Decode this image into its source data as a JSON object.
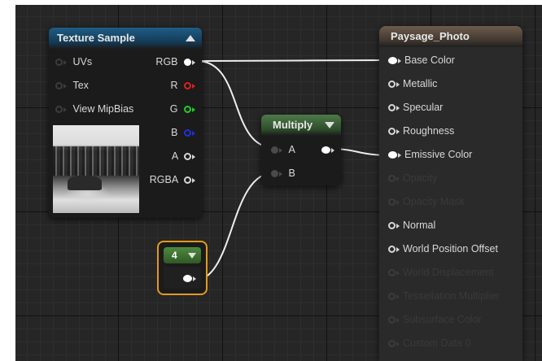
{
  "texture_node": {
    "title": "Texture Sample",
    "inputs": [
      {
        "label": "UVs"
      },
      {
        "label": "Tex"
      },
      {
        "label": "View MipBias"
      }
    ],
    "outputs": [
      {
        "label": "RGB",
        "color": "#ffffff"
      },
      {
        "label": "R",
        "color": "#e02020"
      },
      {
        "label": "G",
        "color": "#20d020"
      },
      {
        "label": "B",
        "color": "#2030e0"
      },
      {
        "label": "A",
        "color": "#d8d8d8"
      },
      {
        "label": "RGBA",
        "color": "#d8d8d8"
      }
    ]
  },
  "multiply_node": {
    "title": "Multiply",
    "inputs": [
      {
        "label": "A"
      },
      {
        "label": "B"
      }
    ]
  },
  "constant_node": {
    "value": "4"
  },
  "material_node": {
    "title": "Paysage_Photo",
    "pins": [
      {
        "label": "Base Color",
        "enabled": true,
        "connected": true
      },
      {
        "label": "Metallic",
        "enabled": true,
        "connected": false
      },
      {
        "label": "Specular",
        "enabled": true,
        "connected": false
      },
      {
        "label": "Roughness",
        "enabled": true,
        "connected": false
      },
      {
        "label": "Emissive Color",
        "enabled": true,
        "connected": true
      },
      {
        "label": "Opacity",
        "enabled": false,
        "connected": false
      },
      {
        "label": "Opacity Mask",
        "enabled": false,
        "connected": false
      },
      {
        "label": "Normal",
        "enabled": true,
        "connected": false
      },
      {
        "label": "World Position Offset",
        "enabled": true,
        "connected": false
      },
      {
        "label": "World Displacement",
        "enabled": false,
        "connected": false
      },
      {
        "label": "Tessellation Multiplier",
        "enabled": false,
        "connected": false
      },
      {
        "label": "Subsurface Color",
        "enabled": false,
        "connected": false
      },
      {
        "label": "Custom Data 0",
        "enabled": false,
        "connected": false
      }
    ]
  },
  "colors": {
    "selection": "#e49a1a",
    "wire": "#ffffff",
    "background": "#262626"
  }
}
